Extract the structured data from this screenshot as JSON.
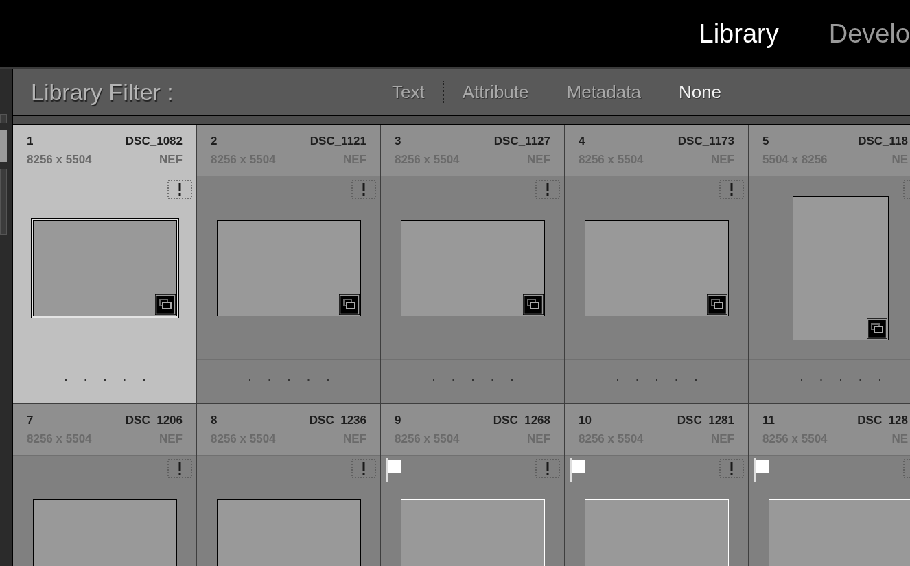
{
  "modules": [
    {
      "label": "Library",
      "selected": true
    },
    {
      "label": "Develo",
      "selected": false
    }
  ],
  "filter_bar": {
    "label": "Library Filter :",
    "options": [
      {
        "label": "Text",
        "selected": false
      },
      {
        "label": "Attribute",
        "selected": false
      },
      {
        "label": "Metadata",
        "selected": false
      },
      {
        "label": "None",
        "selected": true
      }
    ]
  },
  "grid": [
    {
      "index": "1",
      "filename": "DSC_1082",
      "dimensions": "8256 x 5504",
      "format": "NEF",
      "selected": true,
      "flagged": false,
      "kind": "landscape",
      "stacked": true
    },
    {
      "index": "2",
      "filename": "DSC_1121",
      "dimensions": "8256 x 5504",
      "format": "NEF",
      "selected": false,
      "flagged": false,
      "kind": "landscape",
      "stacked": true
    },
    {
      "index": "3",
      "filename": "DSC_1127",
      "dimensions": "8256 x 5504",
      "format": "NEF",
      "selected": false,
      "flagged": false,
      "kind": "landscape",
      "stacked": true
    },
    {
      "index": "4",
      "filename": "DSC_1173",
      "dimensions": "8256 x 5504",
      "format": "NEF",
      "selected": false,
      "flagged": false,
      "kind": "landscape",
      "stacked": true
    },
    {
      "index": "5",
      "filename": "DSC_118",
      "dimensions": "5504 x 8256",
      "format": "NE",
      "selected": false,
      "flagged": false,
      "kind": "portrait",
      "stacked": true
    },
    {
      "index": "7",
      "filename": "DSC_1206",
      "dimensions": "8256 x 5504",
      "format": "NEF",
      "selected": false,
      "flagged": false,
      "kind": "landscape"
    },
    {
      "index": "8",
      "filename": "DSC_1236",
      "dimensions": "8256 x 5504",
      "format": "NEF",
      "selected": false,
      "flagged": false,
      "kind": "landscape"
    },
    {
      "index": "9",
      "filename": "DSC_1268",
      "dimensions": "8256 x 5504",
      "format": "NEF",
      "selected": false,
      "flagged": true,
      "kind": "landscape"
    },
    {
      "index": "10",
      "filename": "DSC_1281",
      "dimensions": "8256 x 5504",
      "format": "NEF",
      "selected": false,
      "flagged": true,
      "kind": "landscape"
    },
    {
      "index": "11",
      "filename": "DSC_128",
      "dimensions": "8256 x 5504",
      "format": "NE",
      "selected": false,
      "flagged": true,
      "kind": "landscape"
    }
  ]
}
